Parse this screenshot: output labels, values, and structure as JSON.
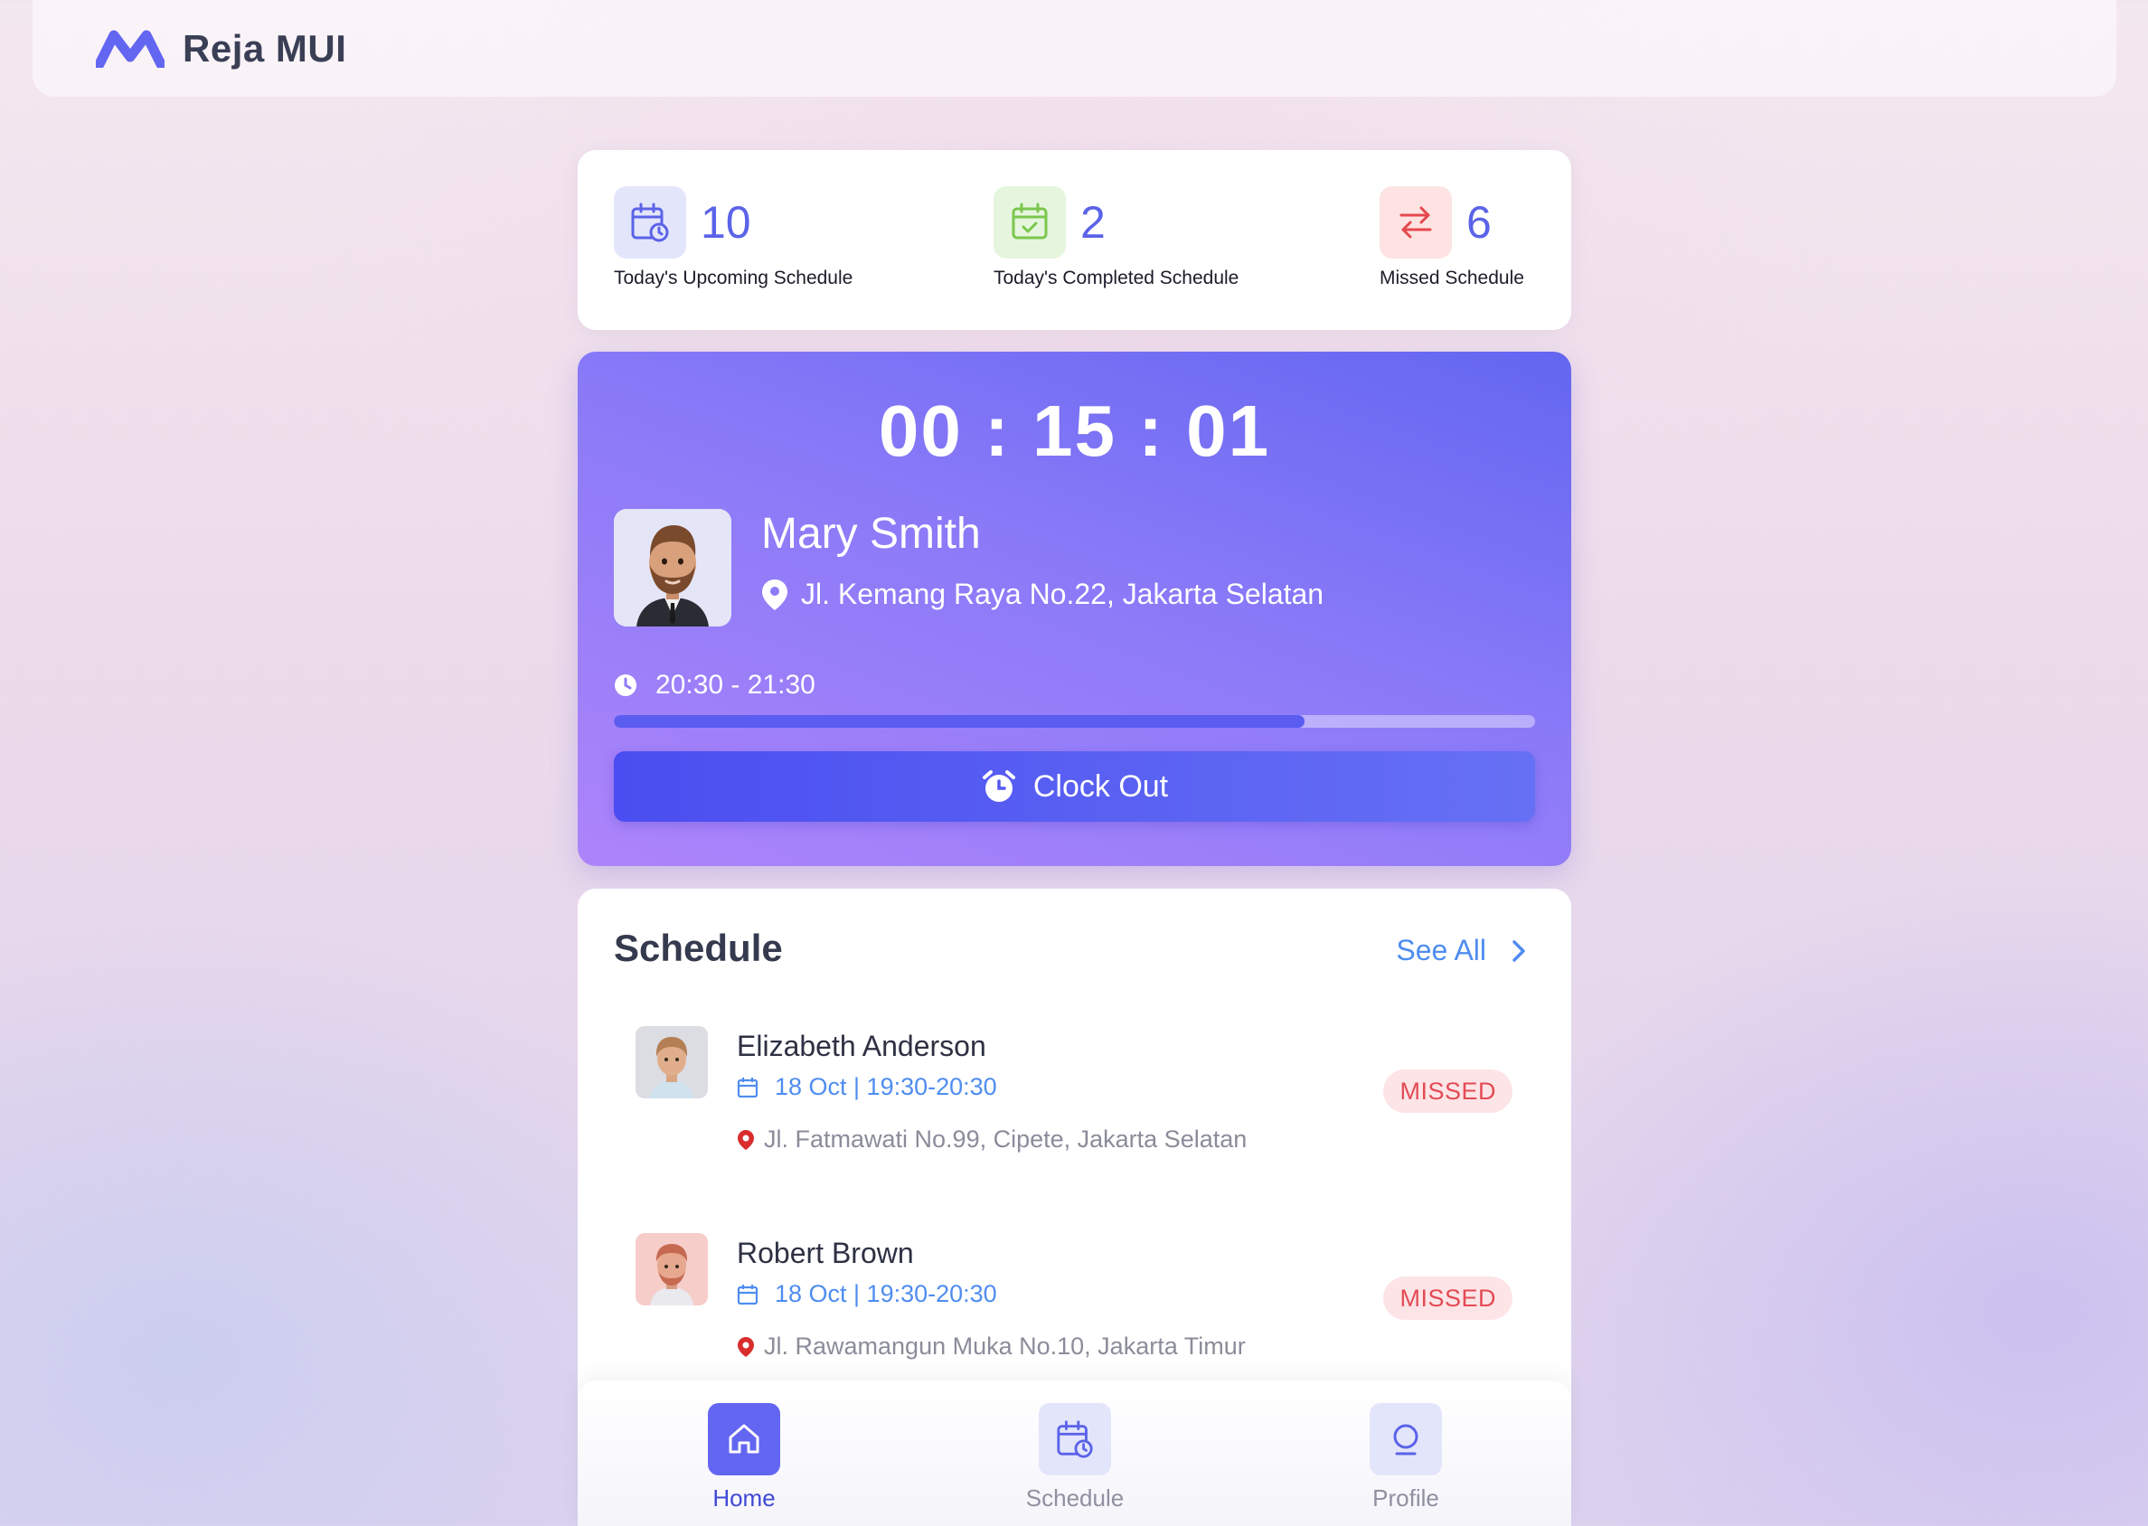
{
  "header": {
    "brand": "Reja MUI"
  },
  "stats": [
    {
      "value": "10",
      "label": "Today's Upcoming Schedule",
      "icon": "calendar-clock-icon",
      "color": "#5b63e8"
    },
    {
      "value": "2",
      "label": "Today's Completed Schedule",
      "icon": "calendar-check-icon",
      "color": "#7bc74d"
    },
    {
      "value": "6",
      "label": "Missed Schedule",
      "icon": "swap-arrows-icon",
      "color": "#e5484d"
    }
  ],
  "active_visit": {
    "timer": "00 : 15 : 01",
    "name": "Mary Smith",
    "address": "Jl. Kemang Raya No.22, Jakarta Selatan",
    "time_range": "20:30 - 21:30",
    "progress_fraction": 0.75,
    "clock_out_label": "Clock Out"
  },
  "schedule": {
    "title": "Schedule",
    "see_all_label": "See All",
    "items": [
      {
        "name": "Elizabeth Anderson",
        "date": "18 Oct | 19:30-20:30",
        "address": "Jl. Fatmawati No.99, Cipete, Jakarta Selatan",
        "status": "MISSED"
      },
      {
        "name": "Robert Brown",
        "date": "18 Oct | 19:30-20:30",
        "address": "Jl. Rawamangun Muka No.10, Jakarta Timur",
        "status": "MISSED"
      }
    ]
  },
  "nav": {
    "home": "Home",
    "schedule": "Schedule",
    "profile": "Profile"
  },
  "colors": {
    "accent": "#6366f1",
    "link": "#4f8df0",
    "missed": "#e34b55"
  }
}
